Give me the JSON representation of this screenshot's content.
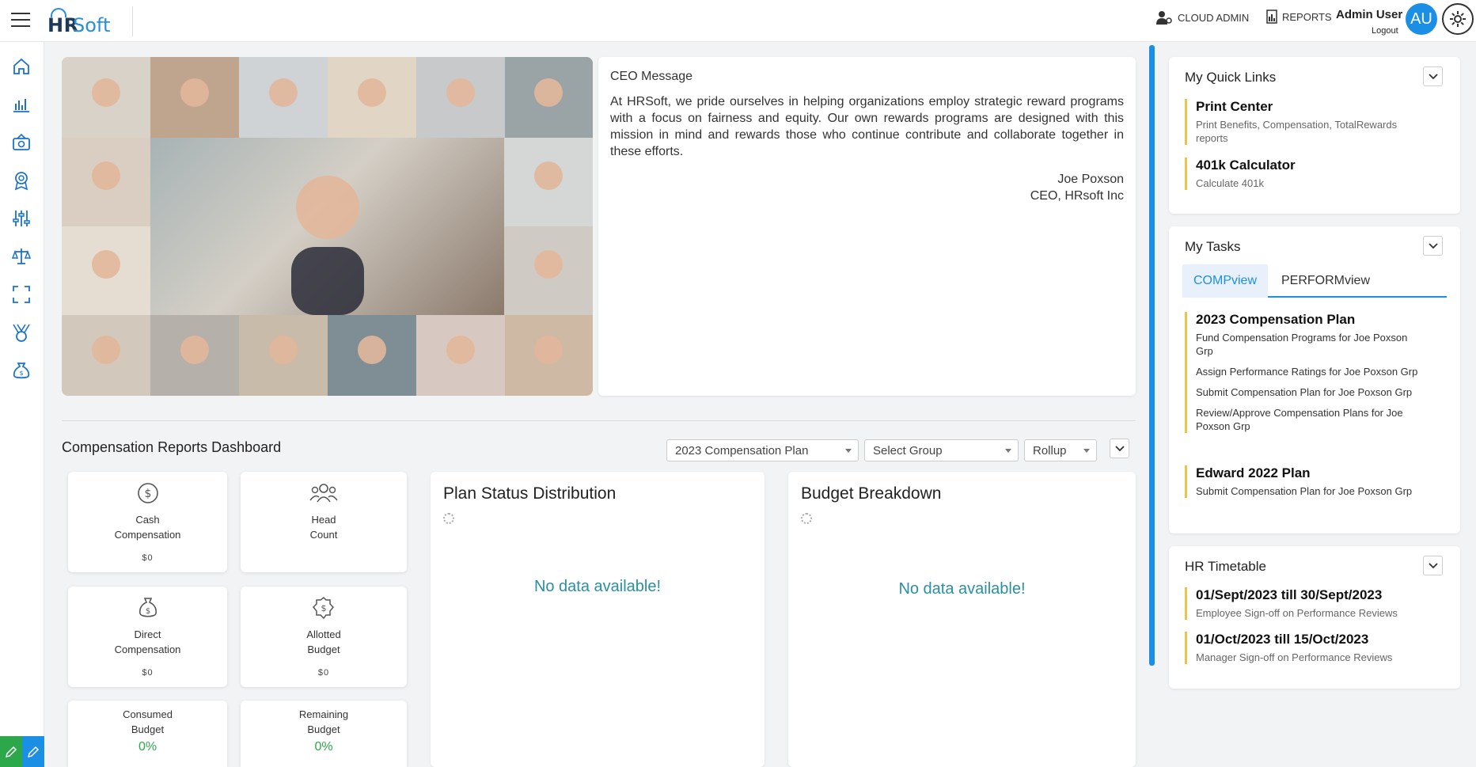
{
  "brand": {
    "logo_hr": "HR",
    "logo_soft": "Soft"
  },
  "header": {
    "cloud_admin": "CLOUD ADMIN",
    "reports": "REPORTS",
    "user_name": "Admin User",
    "logout": "Logout",
    "avatar_initials": "AU"
  },
  "nav_icons": [
    "home-icon",
    "analytics-icon",
    "compensation-icon",
    "award-icon",
    "sliders-icon",
    "balance-scale-icon",
    "expand-icon",
    "medal-icon",
    "money-bag-icon"
  ],
  "ceo": {
    "title": "CEO Message",
    "body": "At HRSoft, we pride ourselves in helping organizations employ strategic reward programs with a focus on fairness and equity. Our own rewards programs are designed with this mission in mind and rewards those who continue contribute and collaborate together in these efforts.",
    "name": "Joe Poxson",
    "role": "CEO, HRsoft Inc"
  },
  "dashboard": {
    "title": "Compensation Reports Dashboard",
    "plan_select": "2023 Compensation Plan",
    "group_select": "Select Group",
    "rollup_select": "Rollup",
    "metrics": {
      "cash": {
        "label1": "Cash",
        "label2": "Compensation",
        "value": "$0"
      },
      "headcount": {
        "label1": "Head",
        "label2": "Count"
      },
      "direct": {
        "label1": "Direct",
        "label2": "Compensation",
        "value": "$0"
      },
      "allotted": {
        "label1": "Allotted",
        "label2": "Budget",
        "value": "$0"
      },
      "consumed": {
        "label1": "Consumed",
        "label2": "Budget",
        "value": "0%"
      },
      "remaining": {
        "label1": "Remaining",
        "label2": "Budget",
        "value": "0%"
      }
    },
    "plan_status": {
      "title": "Plan Status Distribution",
      "empty": "No data available!"
    },
    "budget": {
      "title": "Budget Breakdown",
      "empty": "No data available!"
    }
  },
  "quick_links": {
    "title": "My Quick Links",
    "items": [
      {
        "title": "Print Center",
        "desc": "Print Benefits, Compensation, TotalRewards reports"
      },
      {
        "title": "401k Calculator",
        "desc": "Calculate 401k"
      }
    ]
  },
  "tasks": {
    "title": "My Tasks",
    "tab_active": "COMPview",
    "tab_inactive": "PERFORMview",
    "plans": [
      {
        "title": "2023 Compensation Plan",
        "items": [
          "Fund Compensation Programs for Joe Poxson Grp",
          "Assign Performance Ratings for Joe Poxson Grp",
          "Submit Compensation Plan for Joe Poxson Grp",
          "Review/Approve Compensation Plans for Joe Poxson Grp"
        ]
      },
      {
        "title": "Edward 2022 Plan",
        "items": [
          "Submit Compensation Plan for Joe Poxson Grp"
        ]
      }
    ]
  },
  "timetable": {
    "title": "HR Timetable",
    "items": [
      {
        "title": "01/Sept/2023 till 30/Sept/2023",
        "desc": "Employee Sign-off on Performance Reviews"
      },
      {
        "title": "01/Oct/2023 till 15/Oct/2023",
        "desc": "Manager Sign-off on Performance Reviews"
      }
    ]
  },
  "colors": {
    "accent": "#1a8fe3",
    "link_bar": "#f0c14b",
    "nodata": "#2a8fa0",
    "percent": "#2ca84b",
    "nav_icon": "#1a73c8"
  }
}
